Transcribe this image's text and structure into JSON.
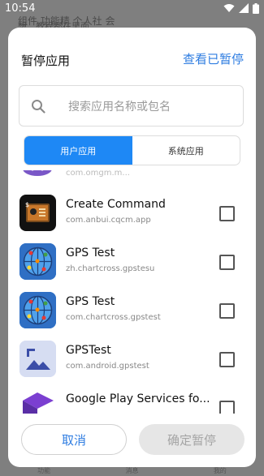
{
  "status_bar": {
    "time": "10:54"
  },
  "background": {
    "line1": "组件 功能精 个人社 会",
    "line2": "想、教程都在里面",
    "bottom_tabs": [
      "功能",
      "消息",
      "我的"
    ]
  },
  "dialog": {
    "title": "暂停应用",
    "view_paused_link": "查看已暂停",
    "search_placeholder": "搜索应用名称或包名",
    "tabs": [
      {
        "label": "用户应用",
        "active": true
      },
      {
        "label": "系统应用",
        "active": false
      }
    ],
    "apps": [
      {
        "name": "",
        "package": "com.omgm.m..."
      },
      {
        "name": "Create Command",
        "package": "com.anbui.cqcm.app"
      },
      {
        "name": "GPS Test",
        "package": "zh.chartcross.gpstesu"
      },
      {
        "name": "GPS Test",
        "package": "com.chartcross.gpstest"
      },
      {
        "name": "GPSTest",
        "package": "com.android.gpstest"
      },
      {
        "name": "Google Play Services fo...",
        "package": ""
      }
    ],
    "cancel_label": "取消",
    "confirm_label": "确定暂停"
  },
  "colors": {
    "accent": "#2f7de1",
    "tab_active": "#1e88f5",
    "disabled_button": "#e6e6e6"
  }
}
